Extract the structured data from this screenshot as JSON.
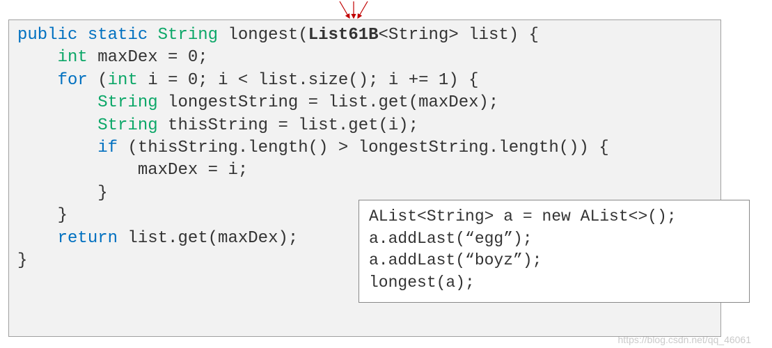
{
  "code": {
    "l1_kw1": "public",
    "l1_kw2": "static",
    "l1_type1": "String",
    "l1_name": "longest(",
    "l1_bold": "List61B",
    "l1_rest": "<String> list) {",
    "l2_type": "int",
    "l2_rest": " maxDex = 0;",
    "l3_kw": "for",
    "l3_paren": " (",
    "l3_type": "int",
    "l3_rest": " i = 0; i < list.size(); i += 1) {",
    "l4_type": "String",
    "l4_rest": " longestString = list.get(maxDex);",
    "l5_type": "String",
    "l5_rest": " thisString = list.get(i);",
    "l6_kw": "if",
    "l6_rest": " (thisString.length() > longestString.length()) {",
    "l7": "            maxDex = i;",
    "l8": "        }",
    "l9": "    }",
    "l10": "",
    "l11_kw": "return",
    "l11_rest": " list.get(maxDex);",
    "l12": "}"
  },
  "inset": {
    "l1": "AList<String> a = new AList<>();",
    "l2": "a.addLast(“egg”);",
    "l3": "a.addLast(“boyz”);",
    "l4": "longest(a);"
  },
  "watermark": "https://blog.csdn.net/qq_46061"
}
